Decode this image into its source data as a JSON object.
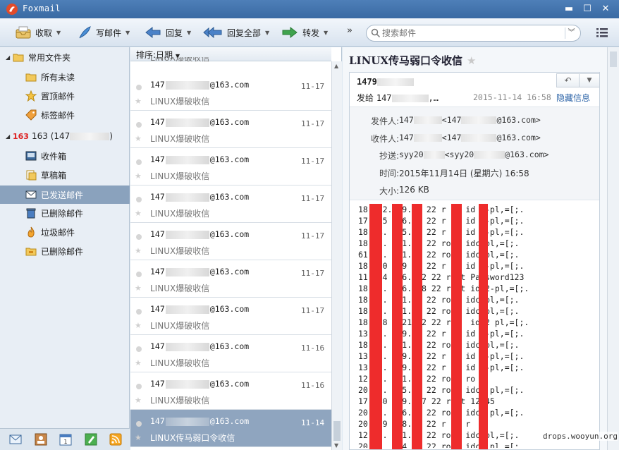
{
  "app": {
    "title": "Foxmail"
  },
  "window_controls": {
    "minimize": "▬",
    "maximize": "☐",
    "close": "✕"
  },
  "toolbar": {
    "receive": "收取",
    "compose": "写邮件",
    "reply": "回复",
    "reply_all": "回复全部",
    "forward": "转发",
    "more": "»",
    "search_placeholder": "搜索邮件"
  },
  "sidebar": {
    "common_folder": "常用文件夹",
    "common_items": [
      "所有未读",
      "置顶邮件",
      "标签邮件"
    ],
    "account_badge": "163",
    "account_label": "163 (147",
    "account_label_end": ")",
    "account_items": [
      "收件箱",
      "草稿箱",
      "已发送邮件",
      "已删除邮件",
      "垃圾邮件",
      "已删除邮件"
    ],
    "selected_item": "已发送邮件"
  },
  "list": {
    "sort_label": "排序:日期",
    "top_partial_subject": "LINUX爆破收信",
    "messages": [
      {
        "from_prefix": "147",
        "from_suffix": "@163.com",
        "subject": "LINUX爆破收信",
        "date": "11-17"
      },
      {
        "from_prefix": "147",
        "from_suffix": "@163.com",
        "subject": "LINUX爆破收信",
        "date": "11-17"
      },
      {
        "from_prefix": "147",
        "from_suffix": "@163.com",
        "subject": "LINUX爆破收信",
        "date": "11-17"
      },
      {
        "from_prefix": "147",
        "from_suffix": "@163.com",
        "subject": "LINUX爆破收信",
        "date": "11-17"
      },
      {
        "from_prefix": "147",
        "from_suffix": "@163.com",
        "subject": "LINUX爆破收信",
        "date": "11-17"
      },
      {
        "from_prefix": "147",
        "from_suffix": "@163.com",
        "subject": "LINUX爆破收信",
        "date": "11-17"
      },
      {
        "from_prefix": "147",
        "from_suffix": "@163.com",
        "subject": "LINUX爆破收信",
        "date": "11-17"
      },
      {
        "from_prefix": "147",
        "from_suffix": "@163.com",
        "subject": "LINUX爆破收信",
        "date": "11-16"
      },
      {
        "from_prefix": "147",
        "from_suffix": "@163.com",
        "subject": "LINUX爆破收信",
        "date": "11-16"
      },
      {
        "from_prefix": "147",
        "from_suffix": "@163.com",
        "subject": "LINUX传马弱口令收信",
        "date": "11-14"
      }
    ]
  },
  "reader": {
    "subject": "LINUX传马弱口令收信",
    "sender": "1479",
    "to_label": "发给",
    "to_value": "147",
    "to_ellipsis": ",…",
    "sent_time": "2015-11-14 16:58",
    "hide_info": "隐藏信息",
    "reply_glyph": "↶",
    "more_glyph": "▼",
    "details": [
      {
        "key": "发件人:",
        "value_prefix": "147",
        "value_mid": "<147",
        "value_suffix": "@163.com>"
      },
      {
        "key": "收件人:",
        "value_prefix": "147",
        "value_mid": "<147",
        "value_suffix": "@163.com>"
      },
      {
        "key": "抄送:",
        "value_prefix": "syy20",
        "value_mid": "<syy20",
        "value_suffix": "@163.com>"
      },
      {
        "key": "时间:",
        "value": "2015年11月14日 (星期六) 16:58"
      },
      {
        "key": "大小:",
        "value": "126 KB"
      }
    ],
    "body_lines": [
      "18   2.  9. 2 22 r  t id 2-pl,=[;.",
      "17  25   6. 7 22 r  t id 2-pl,=[;.",
      "18  4.   5. 0 22 r  t id 2-pl,=[;.",
      "18  9.   1. 5 22 ro   idc pl,=[;.",
      "61  9.   1. 5 22 ro   idc pl,=[;.",
      "18  50  79  2 22 r  t id 2-pl,=[;.",
      "11  44   6.  2 22 r  t Password123",
      "18  0.   6.  8 22 r  t id 2-pl,=[;.",
      "18  5.   1. 5 22 ro   idc pl,=[;.",
      "18  5.   1. 5 22 ro   idc pl,=[;.",
      "18  .8   21  2 22 roo  idc2 pl,=[;.",
      "13  9.   9. 9 22 r  t id 2-pl,=[;.",
      "18  5.   1. 5 22 ro   idc pl,=[;.",
      "13  9.   9. 4 22 r  t id 2-pl,=[;.",
      "13  9.   9. 3 22 r  t id 2-pl,=[;.",
      "12  5.   1. 5 22 ro   ro",
      "20  3.   5. 2 22 roo  idc2 pl,=[;.",
      "17  40   9.  7 22 r  t 12 45",
      "20  3.   6. 2 22 roo  idc2 pl,=[;.",
      "20  39   8. 8 22 r  t r  t",
      "12  3.   1. 5 22 ro   idc pl,=[;.",
      "20  3    4. 0 22 roo  idc2 pl,=[;."
    ]
  },
  "watermark": "drops.wooyun.org",
  "colors": {
    "titlebar": "#3a6aa3",
    "selected": "#8aa2bd",
    "redaction": "#ee2c2c",
    "link": "#2d64a8"
  }
}
